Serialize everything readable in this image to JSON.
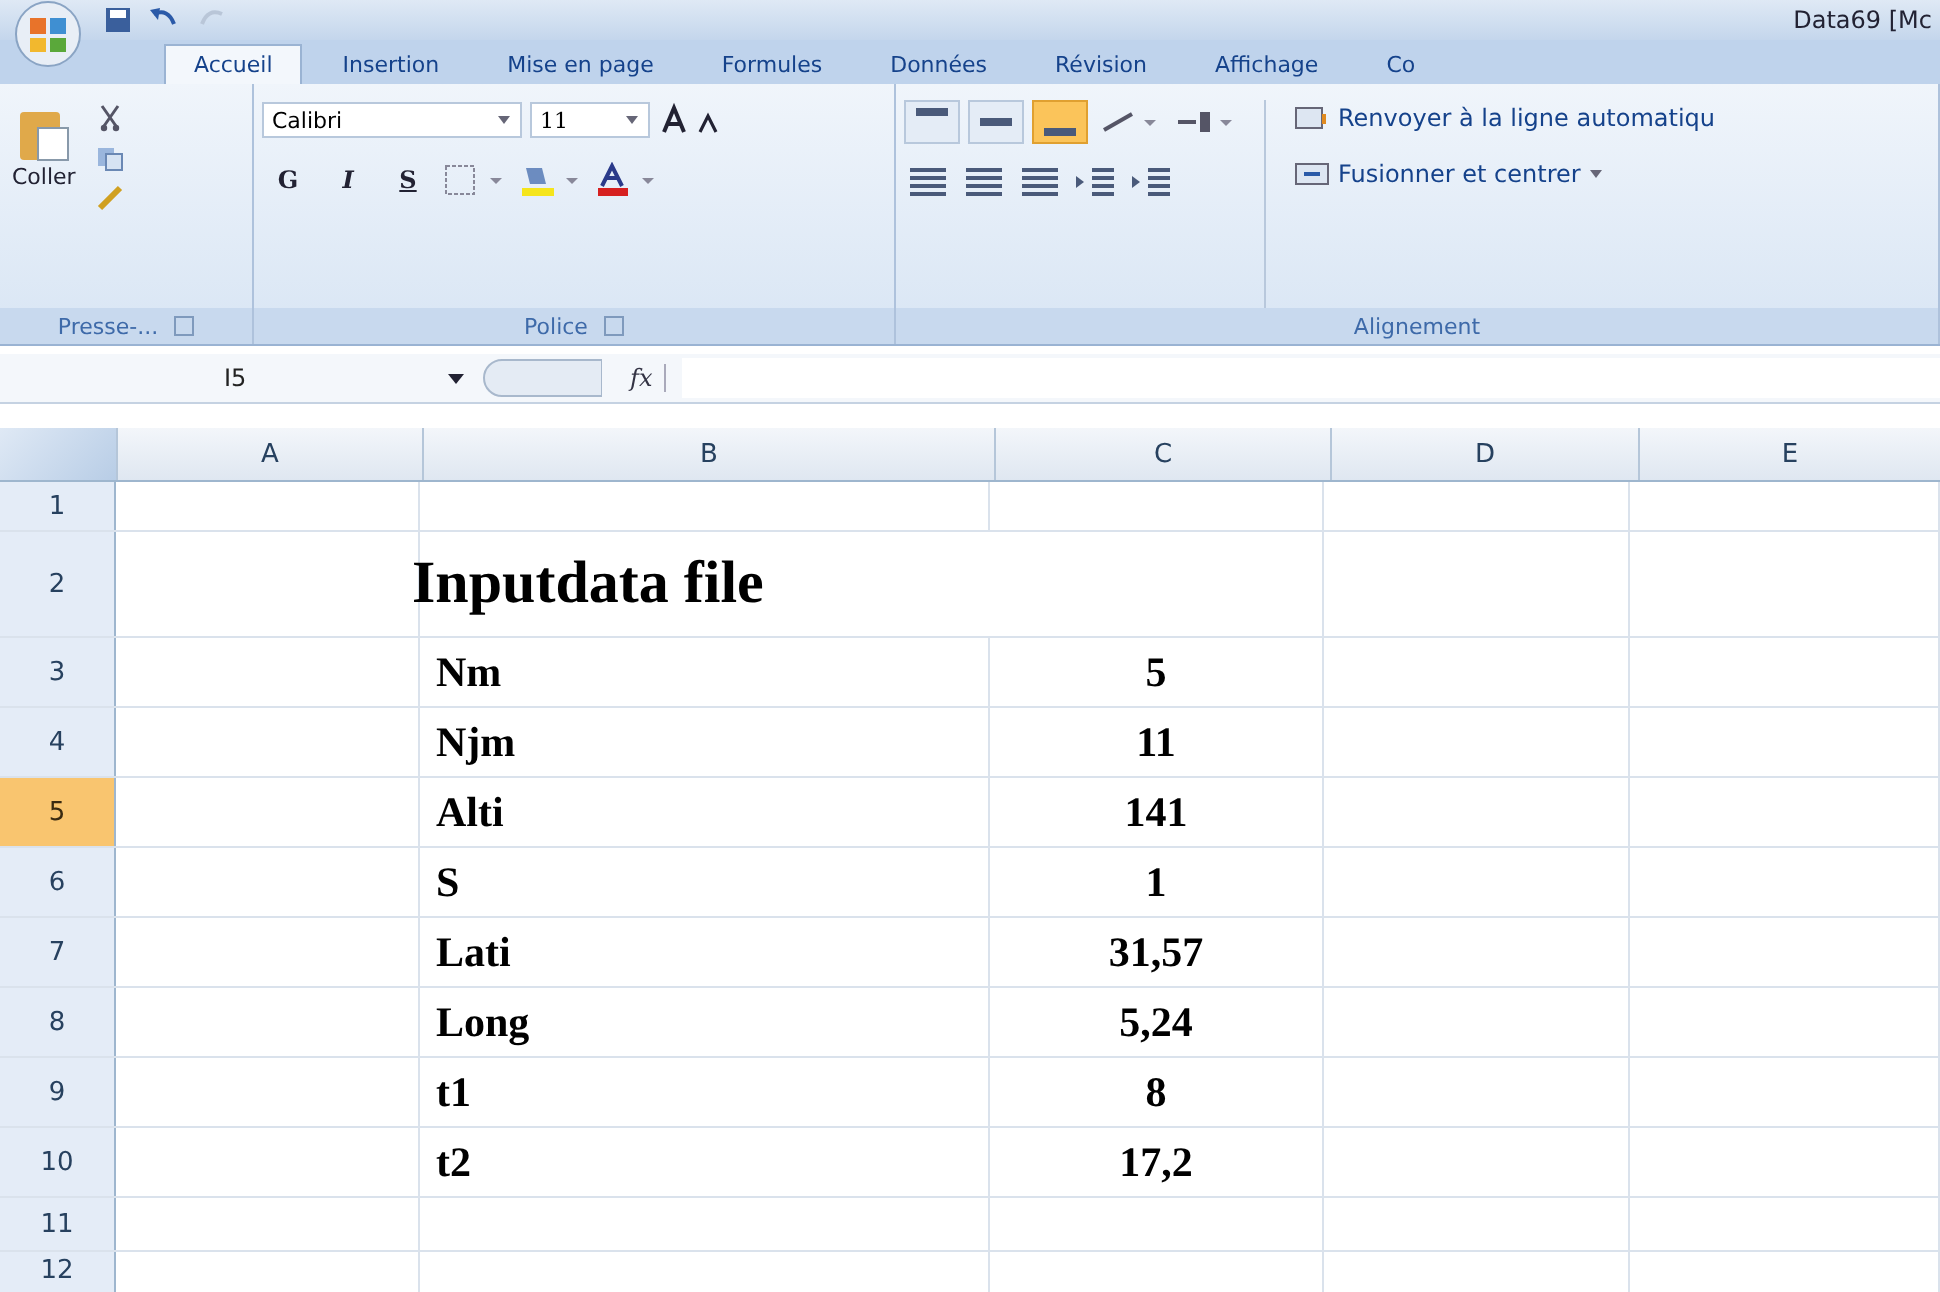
{
  "window": {
    "title": "Data69 [Mc"
  },
  "tabs": [
    {
      "label": "Accueil",
      "selected": true
    },
    {
      "label": "Insertion",
      "selected": false
    },
    {
      "label": "Mise en page",
      "selected": false
    },
    {
      "label": "Formules",
      "selected": false
    },
    {
      "label": "Données",
      "selected": false
    },
    {
      "label": "Révision",
      "selected": false
    },
    {
      "label": "Affichage",
      "selected": false
    },
    {
      "label": "Co",
      "selected": false
    }
  ],
  "ribbon": {
    "clipboard": {
      "paste": "Coller",
      "group": "Presse-..."
    },
    "font": {
      "family": "Calibri",
      "size": "11",
      "bold": "G",
      "italic": "I",
      "underline": "S",
      "group": "Police"
    },
    "alignment": {
      "vertical": [
        {
          "selected": false
        },
        {
          "selected": false
        },
        {
          "selected": true
        }
      ],
      "wrap": "Renvoyer à la ligne automatiqu",
      "merge": "Fusionner et centrer",
      "group": "Alignement"
    }
  },
  "formula_bar": {
    "name_box": "I5",
    "function_label": "fx"
  },
  "sheet": {
    "columns": [
      "A",
      "B",
      "C",
      "D",
      "E"
    ],
    "rows": [
      {
        "number": "1",
        "selected": false,
        "kind": "empty"
      },
      {
        "number": "2",
        "selected": false,
        "kind": "title",
        "text": "Inputdata file"
      },
      {
        "number": "3",
        "selected": false,
        "kind": "pair",
        "label": "Nm",
        "value": "5"
      },
      {
        "number": "4",
        "selected": false,
        "kind": "pair",
        "label": "Njm",
        "value": "11"
      },
      {
        "number": "5",
        "selected": true,
        "kind": "pair",
        "label": "Alti",
        "value": "141"
      },
      {
        "number": "6",
        "selected": false,
        "kind": "pair",
        "label": "S",
        "value": "1"
      },
      {
        "number": "7",
        "selected": false,
        "kind": "pair",
        "label": "Lati",
        "value": "31,57"
      },
      {
        "number": "8",
        "selected": false,
        "kind": "pair",
        "label": "Long",
        "value": "5,24"
      },
      {
        "number": "9",
        "selected": false,
        "kind": "pair",
        "label": "t1",
        "value": "8"
      },
      {
        "number": "10",
        "selected": false,
        "kind": "pair",
        "label": "t2",
        "value": "17,2"
      },
      {
        "number": "11",
        "selected": false,
        "kind": "empty"
      },
      {
        "number": "12",
        "selected": false,
        "kind": "empty"
      }
    ]
  }
}
